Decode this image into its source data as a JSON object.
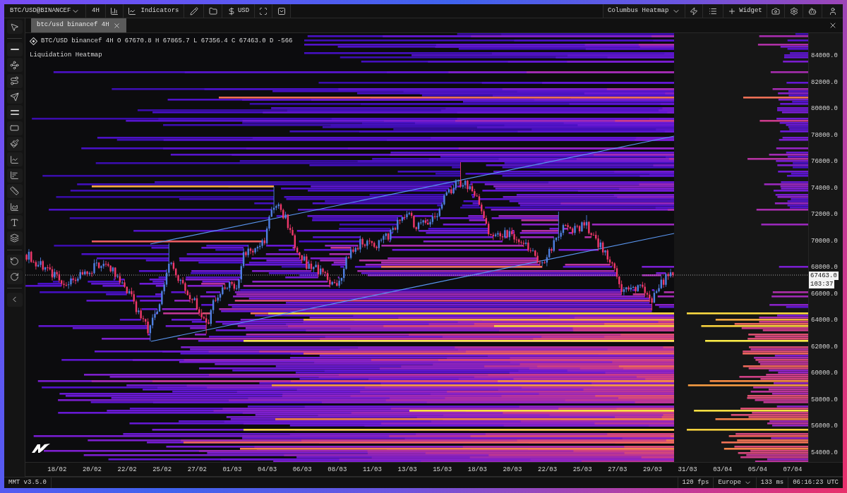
{
  "toolbar": {
    "symbol": "BTC/USD@BINANCEF",
    "interval": "4H",
    "indicators": "Indicators",
    "currency": "USD",
    "layout": "Columbus Heatmap",
    "widget": "Widget"
  },
  "tabs": [
    {
      "label": "btc/usd binancef 4H",
      "selected": true
    }
  ],
  "chart": {
    "legend": "BTC/USD binancef 4H O 67670.8 H 67865.7 L 67356.4 C 67463.0 D -566",
    "indicator": "Liquidation Heatmap",
    "price_labels": [
      "84000.0",
      "82000.0",
      "80000.0",
      "78000.0",
      "76000.0",
      "74000.0",
      "72000.0",
      "70000.0",
      "68000.0",
      "66000.0",
      "64000.0",
      "62000.0",
      "60000.0",
      "58000.0",
      "56000.0",
      "54000.0"
    ],
    "last_price": "67463.0",
    "countdown": "103:37",
    "date_labels": [
      "18/02",
      "20/02",
      "22/02",
      "25/02",
      "27/02",
      "01/03",
      "04/03",
      "06/03",
      "08/03",
      "11/03",
      "13/03",
      "15/03",
      "18/03",
      "20/03",
      "22/03",
      "25/03",
      "27/03",
      "29/03",
      "31/03",
      "03/04",
      "05/04",
      "07/04"
    ]
  },
  "status_bar": {
    "version": "MMT v3.5.0",
    "fps": "120 fps",
    "region": "Europe",
    "latency": "133 ms",
    "clock": "06:16:23 UTC"
  }
}
